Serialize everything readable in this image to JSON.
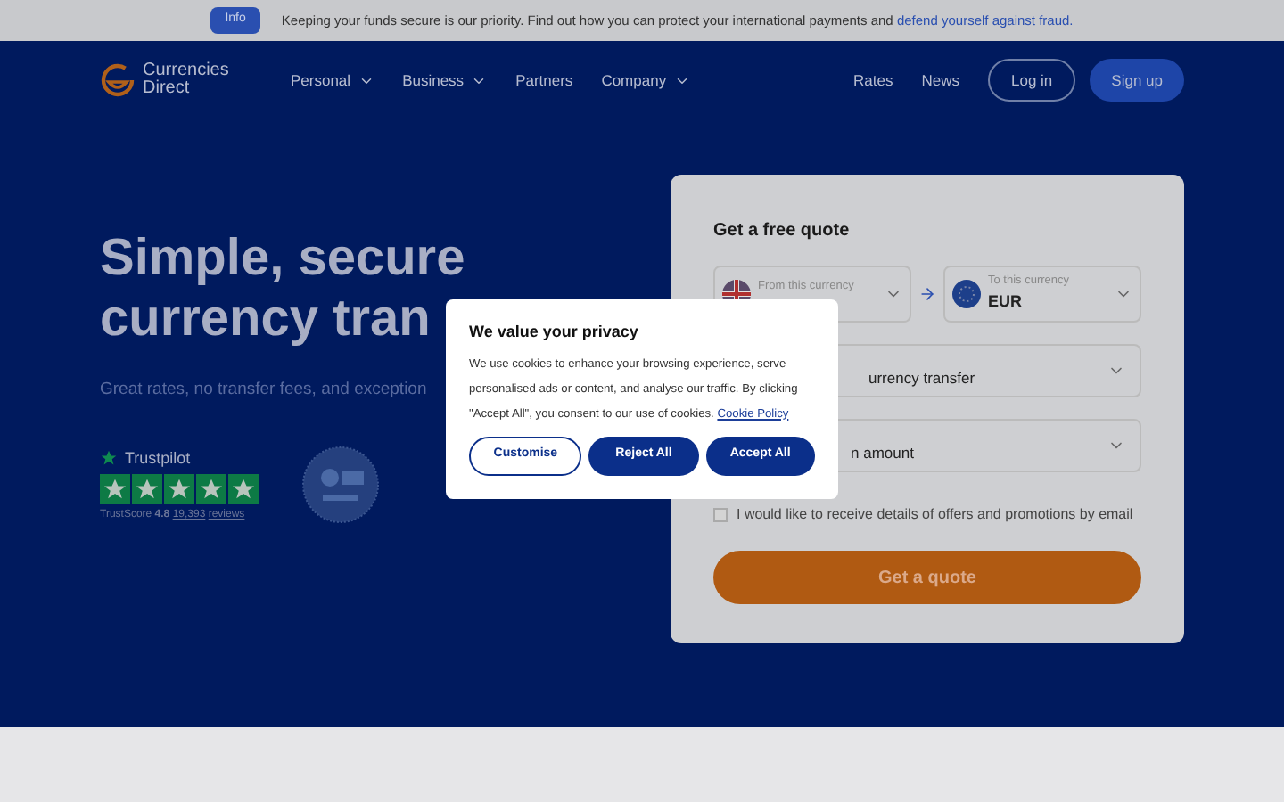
{
  "banner": {
    "badge": "Info",
    "text": "Keeping your funds secure is our priority. Find out how you can protect your international payments and",
    "link": "defend yourself against fraud."
  },
  "nav": {
    "logo": "Currencies Direct",
    "items": [
      {
        "label": "Personal",
        "dropdown": true
      },
      {
        "label": "Business",
        "dropdown": true
      },
      {
        "label": "Partners",
        "dropdown": false
      },
      {
        "label": "Company",
        "dropdown": true
      }
    ],
    "right_links": [
      "Rates",
      "News"
    ],
    "login": "Log in",
    "signup": "Sign up"
  },
  "hero": {
    "title_lines": [
      "Simple, secure",
      "currency tran"
    ],
    "subtitle": "Great rates, no transfer fees, and exception",
    "trustpilot": {
      "name": "Trustpilot",
      "stars": 5,
      "score_label": "TrustScore",
      "score": "4.8",
      "reviews_count": "19,393",
      "reviews_word": "reviews"
    }
  },
  "quote": {
    "title": "Get a free quote",
    "from": {
      "label": "From this currency"
    },
    "to": {
      "label": "To this currency",
      "value": "EUR"
    },
    "transfer_type": "urrency transfer",
    "amount": "n amount",
    "email_opt_in": {
      "label": "I would like to receive details of offers and promotions by email",
      "checked": false
    },
    "button": "Get a quote"
  },
  "cookie_dialog": {
    "title": "We value your privacy",
    "text": "We use cookies to enhance your browsing experience, serve personalised ads or content, and analyse our traffic. By clicking \"Accept All\", you consent to our use of cookies.",
    "link": "Cookie Policy",
    "buttons": [
      {
        "label": "Customise",
        "kind": "outline"
      },
      {
        "label": "Reject All",
        "kind": "filled"
      },
      {
        "label": "Accept All",
        "kind": "filled"
      }
    ]
  }
}
